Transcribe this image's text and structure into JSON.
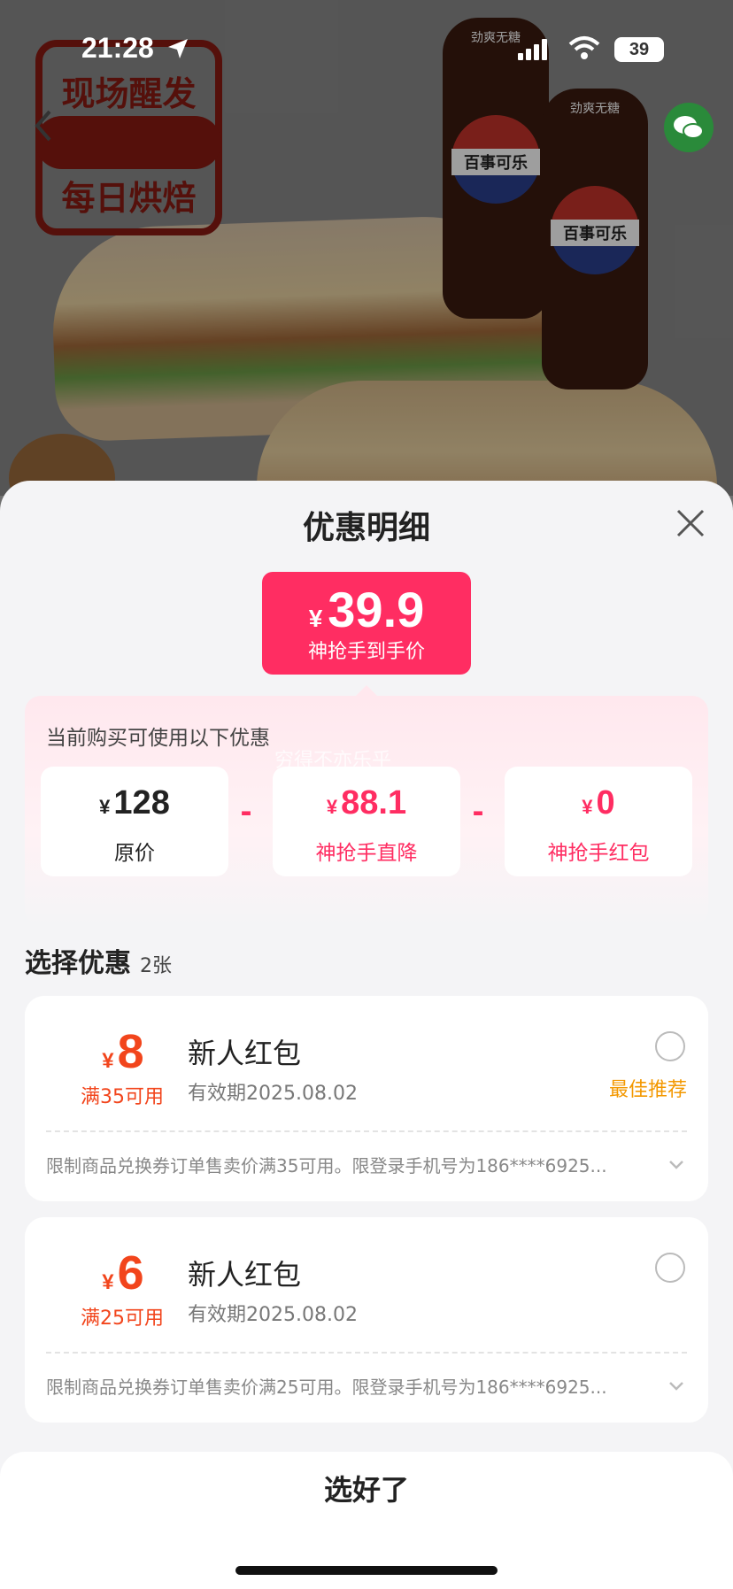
{
  "status_bar": {
    "time": "21:28",
    "battery": "39"
  },
  "hero": {
    "stamp_line1": "现场醒发",
    "stamp_line2": "每日烘焙",
    "bottle_tag": "劲爽无糖",
    "bottle_brand": "百事可乐"
  },
  "sheet": {
    "title": "优惠明细",
    "price": {
      "currency": "¥",
      "amount": "39.9",
      "label": "神抢手到手价"
    },
    "breakdown": {
      "hint": "当前购买可使用以下优惠",
      "watermark": "穷得不亦乐乎",
      "items": [
        {
          "currency": "¥",
          "value": "128",
          "label": "原价"
        },
        {
          "currency": "¥",
          "value": "88.1",
          "label": "神抢手直降"
        },
        {
          "currency": "¥",
          "value": "0",
          "label": "神抢手红包"
        }
      ],
      "operator": "-"
    },
    "select": {
      "title": "选择优惠",
      "count": "2张"
    },
    "coupons": [
      {
        "currency": "¥",
        "amount": "8",
        "condition": "满35可用",
        "name": "新人红包",
        "validity": "有效期2025.08.02",
        "badge": "最佳推荐",
        "description": "限制商品兑换券订单售卖价满35可用。限登录手机号为186****6925..."
      },
      {
        "currency": "¥",
        "amount": "6",
        "condition": "满25可用",
        "name": "新人红包",
        "validity": "有效期2025.08.02",
        "badge": "",
        "description": "限制商品兑换券订单售卖价满25可用。限登录手机号为186****6925..."
      }
    ]
  },
  "footer": {
    "confirm_label": "选好了"
  },
  "colors": {
    "accent": "#ff2d62",
    "coupon_red": "#f2451c",
    "recommend_orange": "#f39800"
  }
}
